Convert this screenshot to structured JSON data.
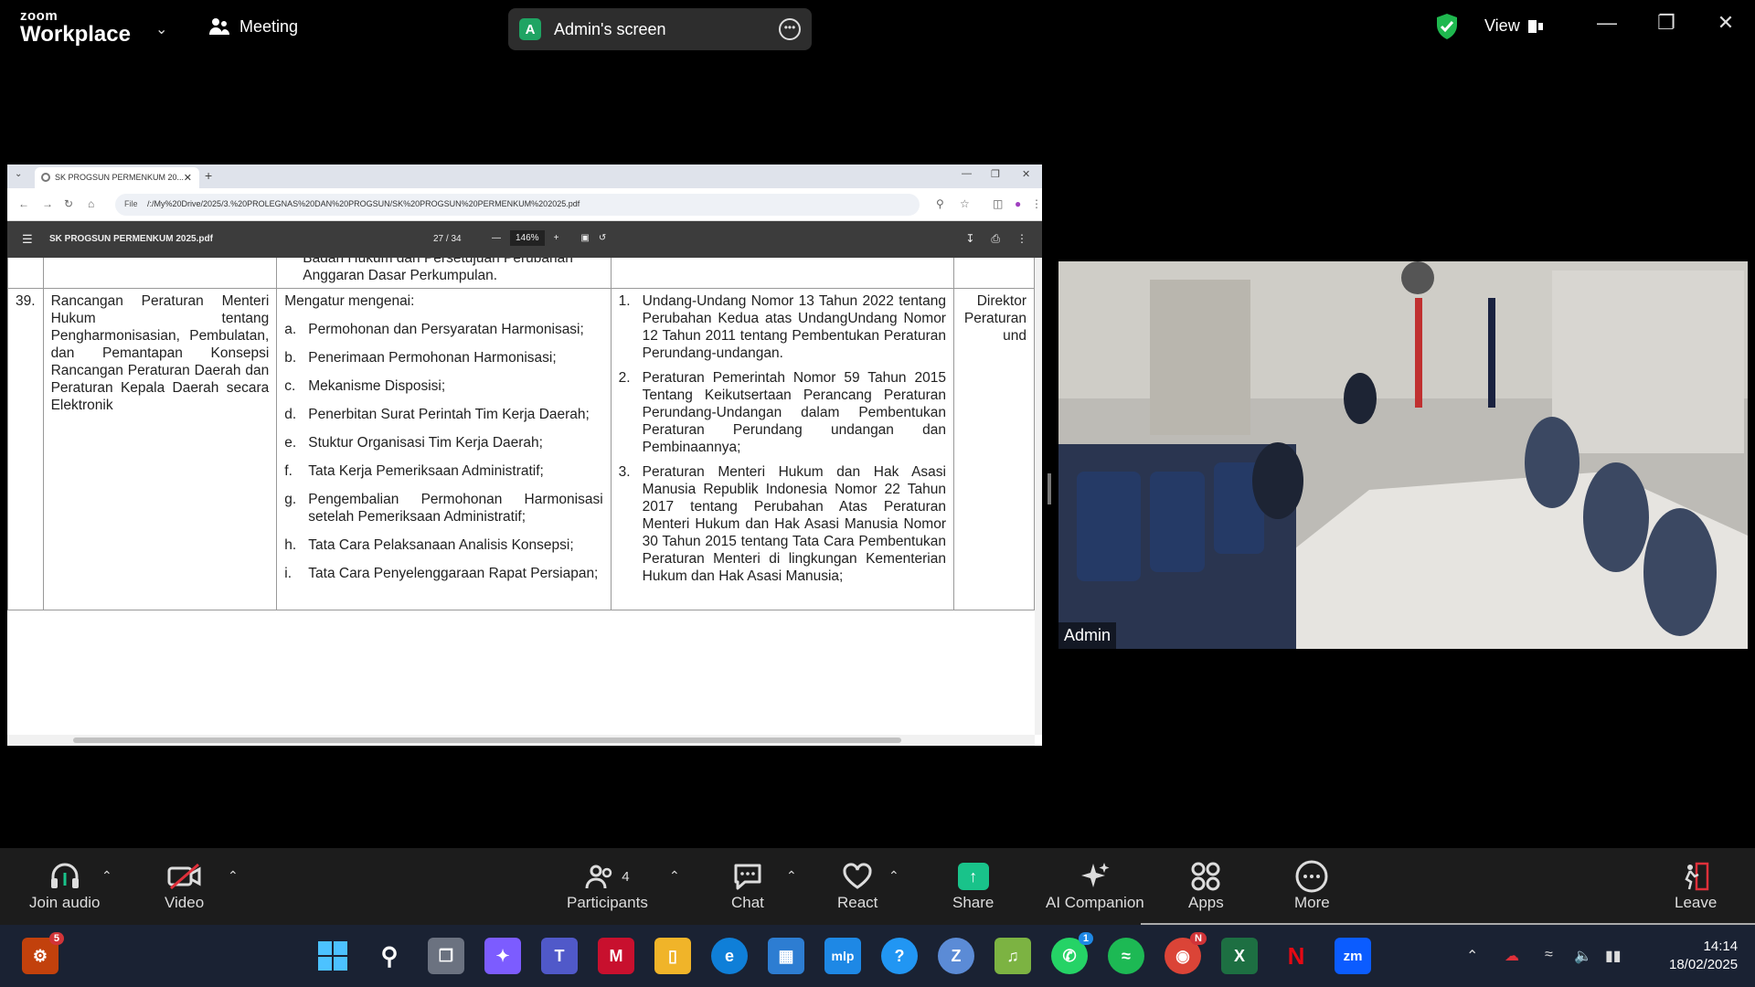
{
  "app": {
    "brand_small": "zoom",
    "brand_big": "Workplace",
    "meeting_label": "Meeting",
    "view_label": "View"
  },
  "screen_share": {
    "avatar_letter": "A",
    "label": "Admin's screen"
  },
  "browser": {
    "tab_title": "SK PROGSUN PERMENKUM 20...",
    "url_prefix": "File",
    "url": "/:/My%20Drive/2025/3.%20PROLEGNAS%20DAN%20PROGSUN/SK%20PROGSUN%20PERMENKUM%202025.pdf"
  },
  "pdf": {
    "title": "SK PROGSUN PERMENKUM 2025.pdf",
    "page_current": "27",
    "page_sep": "/",
    "page_total": "34",
    "zoom": "146%",
    "top_row": {
      "col3": "Badan Hukum dan Persetujuan Perubahan Anggaran Dasar Perkumpulan."
    },
    "row": {
      "number": "39.",
      "title": "Rancangan Peraturan Menteri Hukum tentang Pengharmonisasian, Pembulatan, dan Pemantapan Konsepsi Rancangan Peraturan Daerah dan Peraturan Kepala Daerah secara Elektronik",
      "scope_intro": "Mengatur mengenai:",
      "scope_items": [
        {
          "k": "a.",
          "v": "Permohonan dan Persyaratan Harmonisasi;"
        },
        {
          "k": "b.",
          "v": "Penerimaan Permohonan Harmonisasi;"
        },
        {
          "k": "c.",
          "v": "Mekanisme Disposisi;"
        },
        {
          "k": "d.",
          "v": "Penerbitan Surat Perintah Tim Kerja Daerah;"
        },
        {
          "k": "e.",
          "v": "Stuktur Organisasi Tim Kerja Daerah;"
        },
        {
          "k": "f.",
          "v": "Tata Kerja Pemeriksaan Administratif;"
        },
        {
          "k": "g.",
          "v": "Pengembalian Permohonan Harmonisasi setelah Pemeriksaan Administratif;"
        },
        {
          "k": "h.",
          "v": "Tata Cara Pelaksanaan Analisis Konsepsi;"
        },
        {
          "k": "i.",
          "v": "Tata Cara Penyelenggaraan Rapat Persiapan;"
        }
      ],
      "basis_items": [
        {
          "k": "1.",
          "v": "Undang-Undang Nomor 13 Tahun 2022 tentang Perubahan Kedua atas UndangUndang Nomor 12 Tahun 2011 tentang Pembentukan Peraturan Perundang-undangan."
        },
        {
          "k": "2.",
          "v": "Peraturan Pemerintah Nomor 59 Tahun 2015 Tentang Keikutsertaan Perancang Peraturan Perundang-Undangan dalam Pembentukan Peraturan Perundang undangan dan Pembinaannya;"
        },
        {
          "k": "3.",
          "v": "Peraturan Menteri Hukum dan Hak Asasi Manusia Republik Indonesia Nomor 22 Tahun 2017 tentang Perubahan Atas Peraturan Menteri Hukum dan Hak Asasi Manusia Nomor 30 Tahun 2015 tentang Tata Cara Pembentukan Peraturan Menteri di lingkungan Kementerian Hukum dan Hak Asasi Manusia;"
        }
      ],
      "owner_lines": [
        "Direktor",
        "Peraturan",
        "und"
      ]
    }
  },
  "video": {
    "participant_name": "Admin"
  },
  "toolbar": {
    "join_audio": "Join audio",
    "video": "Video",
    "participants": "Participants",
    "participants_count": "4",
    "chat": "Chat",
    "react": "React",
    "share": "Share",
    "ai_companion": "AI Companion",
    "apps": "Apps",
    "more": "More",
    "leave": "Leave"
  },
  "taskbar": {
    "game_badge": "5",
    "whatsapp_badge": "1",
    "chrome_badge": "N",
    "time": "14:14",
    "date": "18/02/2025"
  },
  "colors": {
    "share_green": "#19c38a",
    "shield_green": "#1fb84f",
    "taskbar_bg": "#1a2233"
  }
}
